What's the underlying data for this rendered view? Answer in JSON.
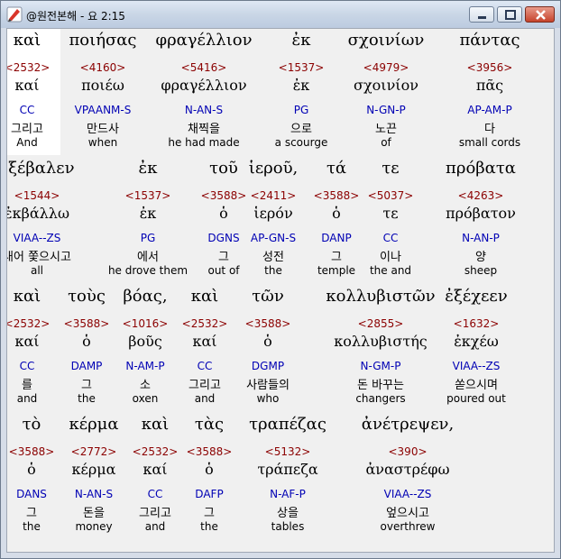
{
  "window": {
    "title": "@원전본해 - 요 2:15"
  },
  "rows": [
    {
      "words": [
        {
          "greek": "καὶ",
          "strong": "<2532>",
          "lemma": "καί",
          "parse": "CC",
          "korean": "그리고",
          "english": "And",
          "highlight": true
        },
        {
          "greek": "ποιήσας",
          "strong": "<4160>",
          "lemma": "ποιέω",
          "parse": "VPAANM-S",
          "korean": "만드사",
          "english": "when"
        },
        {
          "greek": "φραγέλλιον",
          "strong": "<5416>",
          "lemma": "φραγέλλιον",
          "parse": "N-AN-S",
          "korean": "채찍을",
          "english": "he had made"
        },
        {
          "greek": "ἐκ",
          "strong": "<1537>",
          "lemma": "ἐκ",
          "parse": "PG",
          "korean": "으로",
          "english": "a scourge"
        },
        {
          "greek": "σχοινίων",
          "strong": "<4979>",
          "lemma": "σχοινίον",
          "parse": "N-GN-P",
          "korean": "노끈",
          "english": "of"
        },
        {
          "greek": "πάντας",
          "strong": "<3956>",
          "lemma": "πᾶς",
          "parse": "AP-AM-P",
          "korean": "다",
          "english": "small cords"
        }
      ]
    },
    {
      "words": [
        {
          "greek": "ἐξέβαλεν",
          "strong": "<1544>",
          "lemma": "ἐκβάλλω",
          "parse": "VIAA--ZS",
          "korean": "내어 쫓으시고",
          "english": "all"
        },
        {
          "greek": "ἐκ",
          "strong": "<1537>",
          "lemma": "ἐκ",
          "parse": "PG",
          "korean": "에서",
          "english": "he drove them"
        },
        {
          "greek": "τοῦ",
          "strong": "<3588>",
          "lemma": "ὁ",
          "parse": "DGNS",
          "korean": "그",
          "english": "out of"
        },
        {
          "greek": "ἱεροῦ,",
          "strong": "<2411>",
          "lemma": "ἱερόν",
          "parse": "AP-GN-S",
          "korean": "성전",
          "english": "the"
        },
        {
          "greek": "τά",
          "strong": "<3588>",
          "lemma": "ὁ",
          "parse": "DANP",
          "korean": "그",
          "english": "temple"
        },
        {
          "greek": "τε",
          "strong": "<5037>",
          "lemma": "τε",
          "parse": "CC",
          "korean": "이나",
          "english": "the and"
        },
        {
          "greek": "πρόβατα",
          "strong": "<4263>",
          "lemma": "πρόβατον",
          "parse": "N-AN-P",
          "korean": "양",
          "english": "sheep"
        }
      ]
    },
    {
      "words": [
        {
          "greek": "καὶ",
          "strong": "<2532>",
          "lemma": "καί",
          "parse": "CC",
          "korean": "를",
          "english": "and"
        },
        {
          "greek": "τοὺς",
          "strong": "<3588>",
          "lemma": "ὁ",
          "parse": "DAMP",
          "korean": "그",
          "english": "the"
        },
        {
          "greek": "βόας,",
          "strong": "<1016>",
          "lemma": "βοῦς",
          "parse": "N-AM-P",
          "korean": "소",
          "english": "oxen"
        },
        {
          "greek": "καὶ",
          "strong": "<2532>",
          "lemma": "καί",
          "parse": "CC",
          "korean": "그리고",
          "english": "and"
        },
        {
          "greek": "τῶν",
          "strong": "<3588>",
          "lemma": "ὁ",
          "parse": "DGMP",
          "korean": "사람들의",
          "english": "who"
        },
        {
          "greek": "κολλυβιστῶν",
          "strong": "<2855>",
          "lemma": "κολλυβιστής",
          "parse": "N-GM-P",
          "korean": "돈 바꾸는",
          "english": "changers"
        },
        {
          "greek": "ἐξέχεεν",
          "strong": "<1632>",
          "lemma": "ἐκχέω",
          "parse": "VIAA--ZS",
          "korean": "쏟으시며",
          "english": "poured out"
        }
      ]
    },
    {
      "words": [
        {
          "greek": "τὸ",
          "strong": "<3588>",
          "lemma": "ὁ",
          "parse": "DANS",
          "korean": "그",
          "english": "the"
        },
        {
          "greek": "κέρμα",
          "strong": "<2772>",
          "lemma": "κέρμα",
          "parse": "N-AN-S",
          "korean": "돈을",
          "english": "money"
        },
        {
          "greek": "καὶ",
          "strong": "<2532>",
          "lemma": "καί",
          "parse": "CC",
          "korean": "그리고",
          "english": "and"
        },
        {
          "greek": "τὰς",
          "strong": "<3588>",
          "lemma": "ὁ",
          "parse": "DAFP",
          "korean": "그",
          "english": "the"
        },
        {
          "greek": "τραπέζας",
          "strong": "<5132>",
          "lemma": "τράπεζα",
          "parse": "N-AF-P",
          "korean": "상을",
          "english": "tables"
        },
        {
          "greek": "ἀνέτρεψεν,",
          "strong": "<390>",
          "lemma": "ἀναστρέφω",
          "parse": "VIAA--ZS",
          "korean": "엎으시고",
          "english": "overthrew"
        }
      ]
    }
  ]
}
